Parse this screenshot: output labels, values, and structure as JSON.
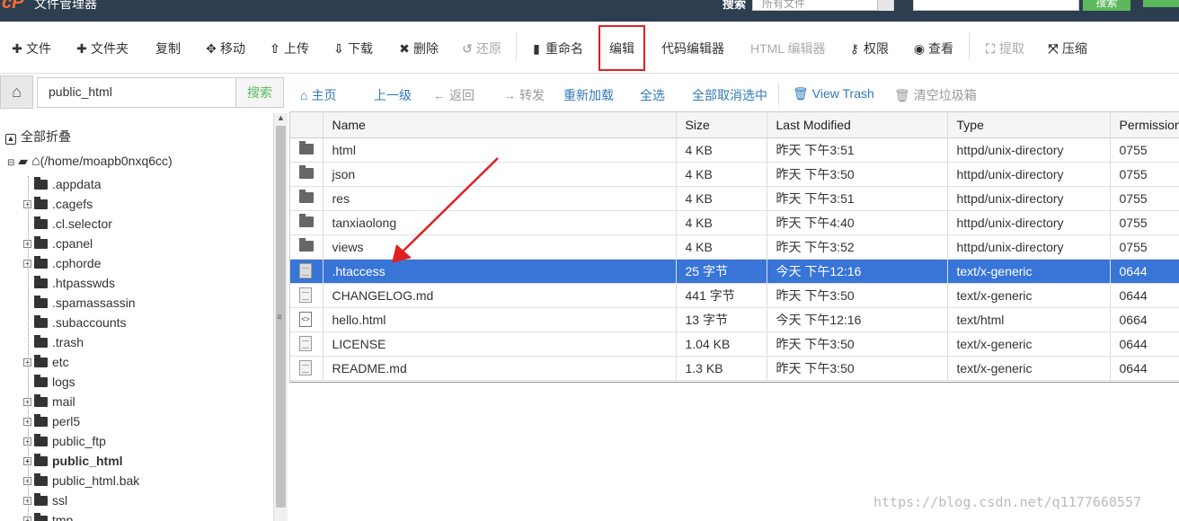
{
  "topbar": {
    "logo": "cP",
    "app_title": "文件管理器",
    "search_label": "搜索",
    "search_scope": "所有文件",
    "search_query": "",
    "search_button": "搜索",
    "extra_button": "+"
  },
  "toolbar": {
    "items": [
      {
        "label": "文件",
        "icon": "plus-icon",
        "enabled": true
      },
      {
        "label": "文件夹",
        "icon": "plus-icon",
        "enabled": true
      },
      {
        "label": "复制",
        "icon": "copy-icon",
        "enabled": true
      },
      {
        "label": "移动",
        "icon": "move-icon",
        "enabled": true
      },
      {
        "label": "上传",
        "icon": "upload-icon",
        "enabled": true
      },
      {
        "label": "下载",
        "icon": "download-icon",
        "enabled": true
      },
      {
        "label": "删除",
        "icon": "delete-icon",
        "enabled": true
      },
      {
        "label": "还原",
        "icon": "undo-icon",
        "enabled": false
      },
      {
        "label": "重命名",
        "icon": "file-icon",
        "enabled": true
      },
      {
        "label": "编辑",
        "icon": "pencil-icon",
        "enabled": true
      },
      {
        "label": "代码编辑器",
        "icon": "code-icon",
        "enabled": true
      },
      {
        "label": "HTML 编辑器",
        "icon": "html-icon",
        "enabled": false
      },
      {
        "label": "权限",
        "icon": "key-icon",
        "enabled": true
      },
      {
        "label": "查看",
        "icon": "eye-icon",
        "enabled": true
      },
      {
        "label": "提取",
        "icon": "expand-icon",
        "enabled": false
      },
      {
        "label": "压缩",
        "icon": "compress-icon",
        "enabled": true
      }
    ]
  },
  "pathbar": {
    "path_value": "public_html",
    "go_button": "搜索"
  },
  "navbar": {
    "items": [
      {
        "label": "主页",
        "icon": "home-icon",
        "enabled": true
      },
      {
        "label": "上一级",
        "icon": "level-up-icon",
        "enabled": true
      },
      {
        "label": "返回",
        "icon": "arrow-left-icon",
        "enabled": false
      },
      {
        "label": "转发",
        "icon": "arrow-right-icon",
        "enabled": false
      },
      {
        "label": "重新加载",
        "icon": "reload-icon",
        "enabled": true
      },
      {
        "label": "全选",
        "icon": "check-icon",
        "enabled": true
      },
      {
        "label": "全部取消选中",
        "icon": "uncheck-icon",
        "enabled": true
      },
      {
        "label": "View Trash",
        "icon": "trash-icon",
        "enabled": true
      },
      {
        "label": "清空垃圾箱",
        "icon": "trash-icon",
        "enabled": false
      }
    ]
  },
  "sidebar": {
    "collapse_all": "全部折叠",
    "root_label": "(/home/moapb0nxq6cc)",
    "items": [
      {
        "label": ".appdata",
        "expandable": false,
        "bold": false
      },
      {
        "label": ".cagefs",
        "expandable": true,
        "bold": false
      },
      {
        "label": ".cl.selector",
        "expandable": false,
        "bold": false
      },
      {
        "label": ".cpanel",
        "expandable": true,
        "bold": false
      },
      {
        "label": ".cphorde",
        "expandable": true,
        "bold": false
      },
      {
        "label": ".htpasswds",
        "expandable": false,
        "bold": false
      },
      {
        "label": ".spamassassin",
        "expandable": false,
        "bold": false
      },
      {
        "label": ".subaccounts",
        "expandable": false,
        "bold": false
      },
      {
        "label": ".trash",
        "expandable": false,
        "bold": false
      },
      {
        "label": "etc",
        "expandable": true,
        "bold": false
      },
      {
        "label": "logs",
        "expandable": false,
        "bold": false
      },
      {
        "label": "mail",
        "expandable": true,
        "bold": false
      },
      {
        "label": "perl5",
        "expandable": true,
        "bold": false
      },
      {
        "label": "public_ftp",
        "expandable": true,
        "bold": false
      },
      {
        "label": "public_html",
        "expandable": true,
        "bold": true
      },
      {
        "label": "public_html.bak",
        "expandable": true,
        "bold": false
      },
      {
        "label": "ssl",
        "expandable": true,
        "bold": false
      },
      {
        "label": "tmp",
        "expandable": true,
        "bold": false
      }
    ]
  },
  "filelist": {
    "columns": [
      "Name",
      "Size",
      "Last Modified",
      "Type",
      "Permissions"
    ],
    "rows": [
      {
        "icon": "folder-icon",
        "name": "html",
        "size": "4 KB",
        "modified": "昨天 下午3:51",
        "type": "httpd/unix-directory",
        "perms": "0755",
        "selected": false
      },
      {
        "icon": "folder-icon",
        "name": "json",
        "size": "4 KB",
        "modified": "昨天 下午3:50",
        "type": "httpd/unix-directory",
        "perms": "0755",
        "selected": false
      },
      {
        "icon": "folder-icon",
        "name": "res",
        "size": "4 KB",
        "modified": "昨天 下午3:51",
        "type": "httpd/unix-directory",
        "perms": "0755",
        "selected": false
      },
      {
        "icon": "folder-icon",
        "name": "tanxiaolong",
        "size": "4 KB",
        "modified": "昨天 下午4:40",
        "type": "httpd/unix-directory",
        "perms": "0755",
        "selected": false
      },
      {
        "icon": "folder-icon",
        "name": "views",
        "size": "4 KB",
        "modified": "昨天 下午3:52",
        "type": "httpd/unix-directory",
        "perms": "0755",
        "selected": false
      },
      {
        "icon": "file-icon",
        "name": ".htaccess",
        "size": "25 字节",
        "modified": "今天 下午12:16",
        "type": "text/x-generic",
        "perms": "0644",
        "selected": true
      },
      {
        "icon": "file-icon",
        "name": "CHANGELOG.md",
        "size": "441 字节",
        "modified": "昨天 下午3:50",
        "type": "text/x-generic",
        "perms": "0644",
        "selected": false
      },
      {
        "icon": "html-file-icon",
        "name": "hello.html",
        "size": "13 字节",
        "modified": "今天 下午12:16",
        "type": "text/html",
        "perms": "0664",
        "selected": false
      },
      {
        "icon": "file-icon",
        "name": "LICENSE",
        "size": "1.04 KB",
        "modified": "昨天 下午3:50",
        "type": "text/x-generic",
        "perms": "0644",
        "selected": false
      },
      {
        "icon": "file-icon",
        "name": "README.md",
        "size": "1.3 KB",
        "modified": "昨天 下午3:50",
        "type": "text/x-generic",
        "perms": "0644",
        "selected": false
      }
    ]
  },
  "annotation": {
    "highlight_color": "#e02020",
    "arrow_color": "#e02020"
  },
  "watermark": "https://blog.csdn.net/q1177660557",
  "colors": {
    "selected_row": "#3875d7",
    "link": "#337ab7",
    "go_green": "#5cb85c",
    "header_bg": "#2c3e50"
  }
}
